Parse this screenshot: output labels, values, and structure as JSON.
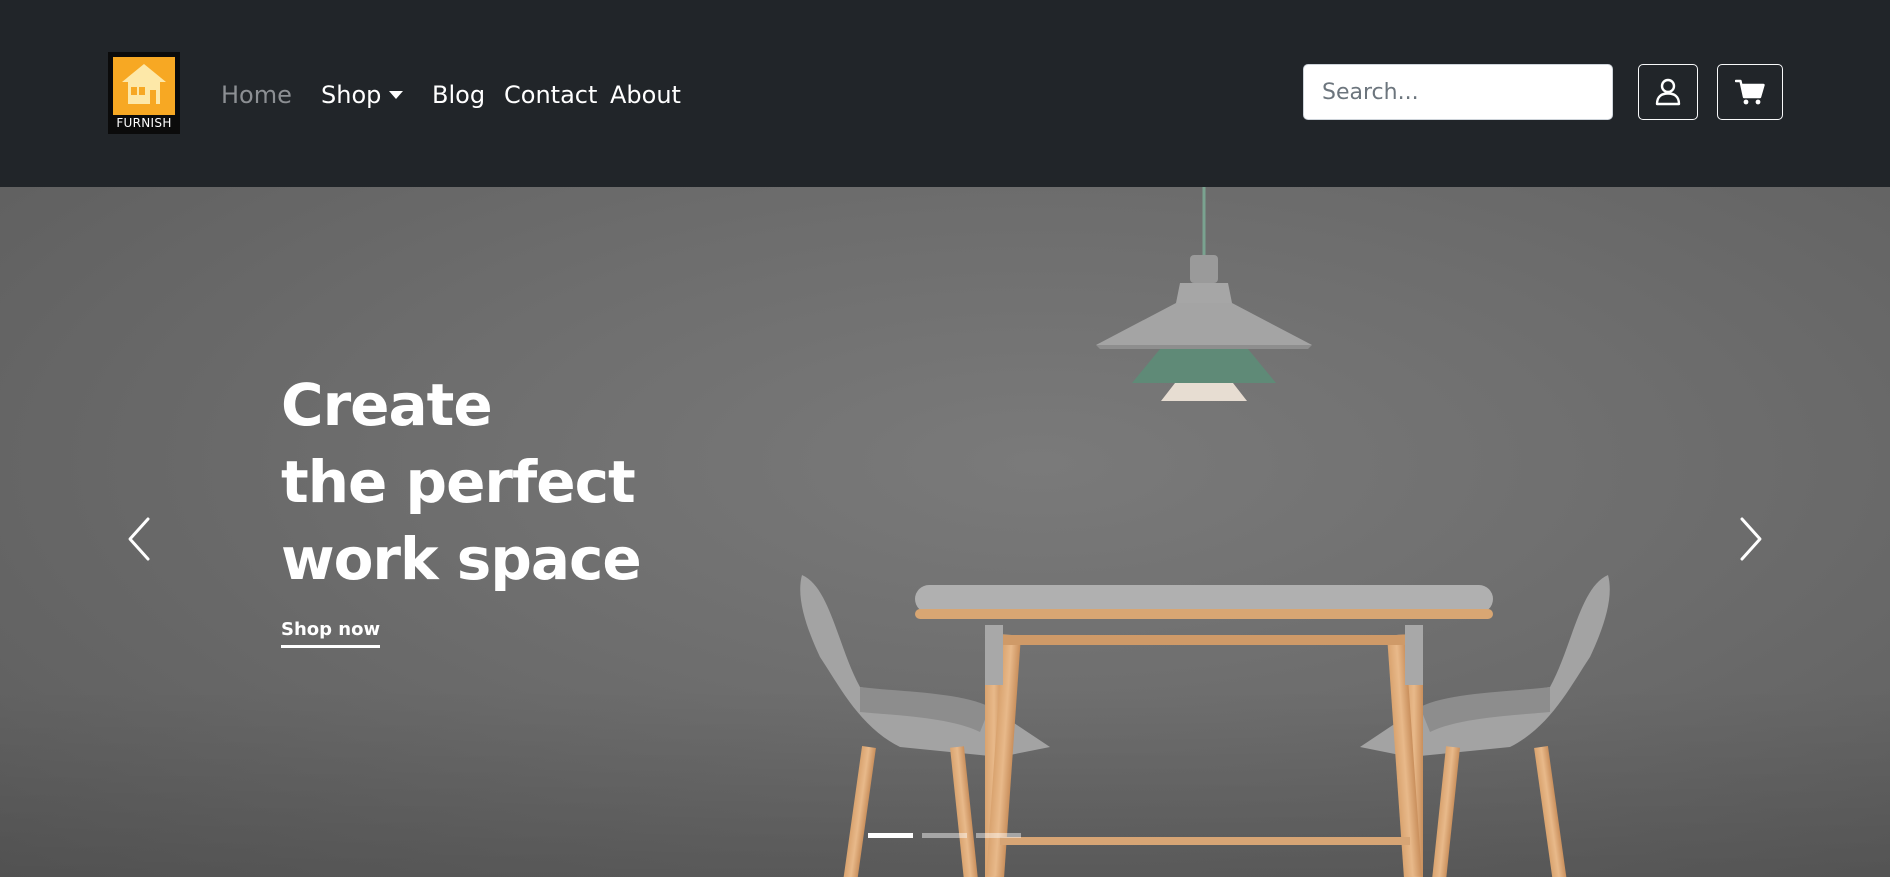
{
  "brand": {
    "logo_icon": "house-icon",
    "logo_text": "FURNISH",
    "logo_color": "#f7a823"
  },
  "nav": {
    "items": [
      {
        "label": "Home",
        "active": true
      },
      {
        "label": "Shop",
        "has_dropdown": true
      },
      {
        "label": "Blog"
      },
      {
        "label": "Contact"
      },
      {
        "label": "About"
      }
    ]
  },
  "search": {
    "placeholder": "Search...",
    "value": ""
  },
  "actions": {
    "account_icon": "user-icon",
    "cart_icon": "cart-icon"
  },
  "hero": {
    "title_lines": [
      "Create",
      "the perfect",
      "work space"
    ],
    "cta_label": "Shop now",
    "slide_count": 3,
    "active_slide": 1,
    "prev_icon": "chevron-left-icon",
    "next_icon": "chevron-right-icon"
  },
  "colors": {
    "navbar_bg": "#212529",
    "nav_active": "#8c8f93",
    "nav_text": "#ffffff",
    "hero_bg": "#6e6e6e"
  }
}
